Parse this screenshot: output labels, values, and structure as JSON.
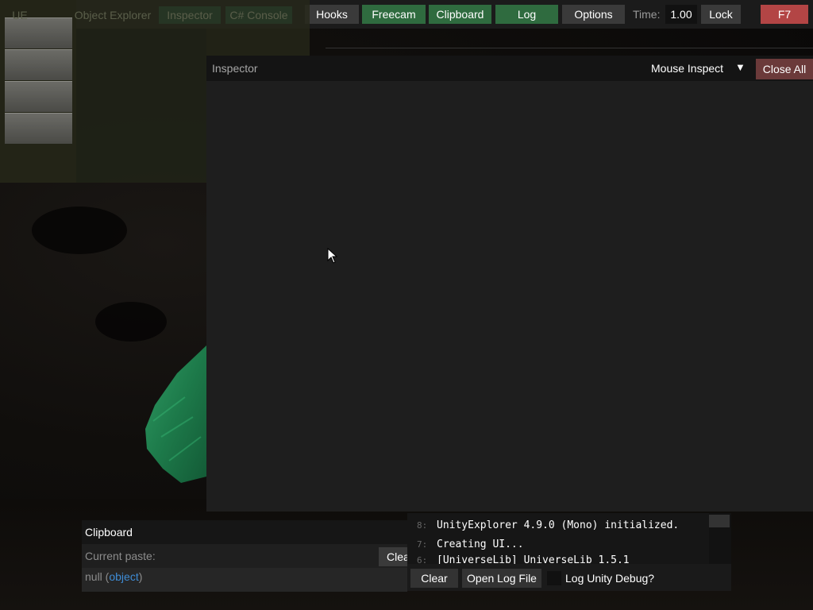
{
  "topbar": {
    "ghost_tabs": [
      "UE",
      "Object Explorer",
      "Inspector",
      "C# Console"
    ],
    "buttons": {
      "hooks": "Hooks",
      "freecam": "Freecam",
      "clipboard": "Clipboard",
      "log": "Log",
      "options": "Options",
      "lock": "Lock",
      "f7": "F7"
    },
    "time_label": "Time:",
    "time_value": "1.00"
  },
  "inspector": {
    "title": "Inspector",
    "mouse_inspect": "Mouse Inspect",
    "caret": "▼",
    "close_all": "Close All"
  },
  "clipboard": {
    "title": "Clipboard",
    "current_paste_label": "Current paste:",
    "clear_label": "Clear",
    "value_null": "null",
    "value_type": "object"
  },
  "log": {
    "lines": [
      {
        "num": "8:",
        "text": "UnityExplorer 4.9.0 (Mono) initialized."
      },
      {
        "num": "7:",
        "text": "Creating UI..."
      },
      {
        "num": "6:",
        "text": "[UniverseLib] UniverseLib 1.5.1"
      }
    ],
    "clear_label": "Clear",
    "open_log_file_label": "Open Log File",
    "log_unity_debug_label": "Log Unity Debug?",
    "log_unity_debug_checked": false
  },
  "colors": {
    "green_button": "#2f6b3f",
    "red_button": "#b34545",
    "close_all": "#6b3a3a",
    "type_link": "#3e8cd6"
  }
}
